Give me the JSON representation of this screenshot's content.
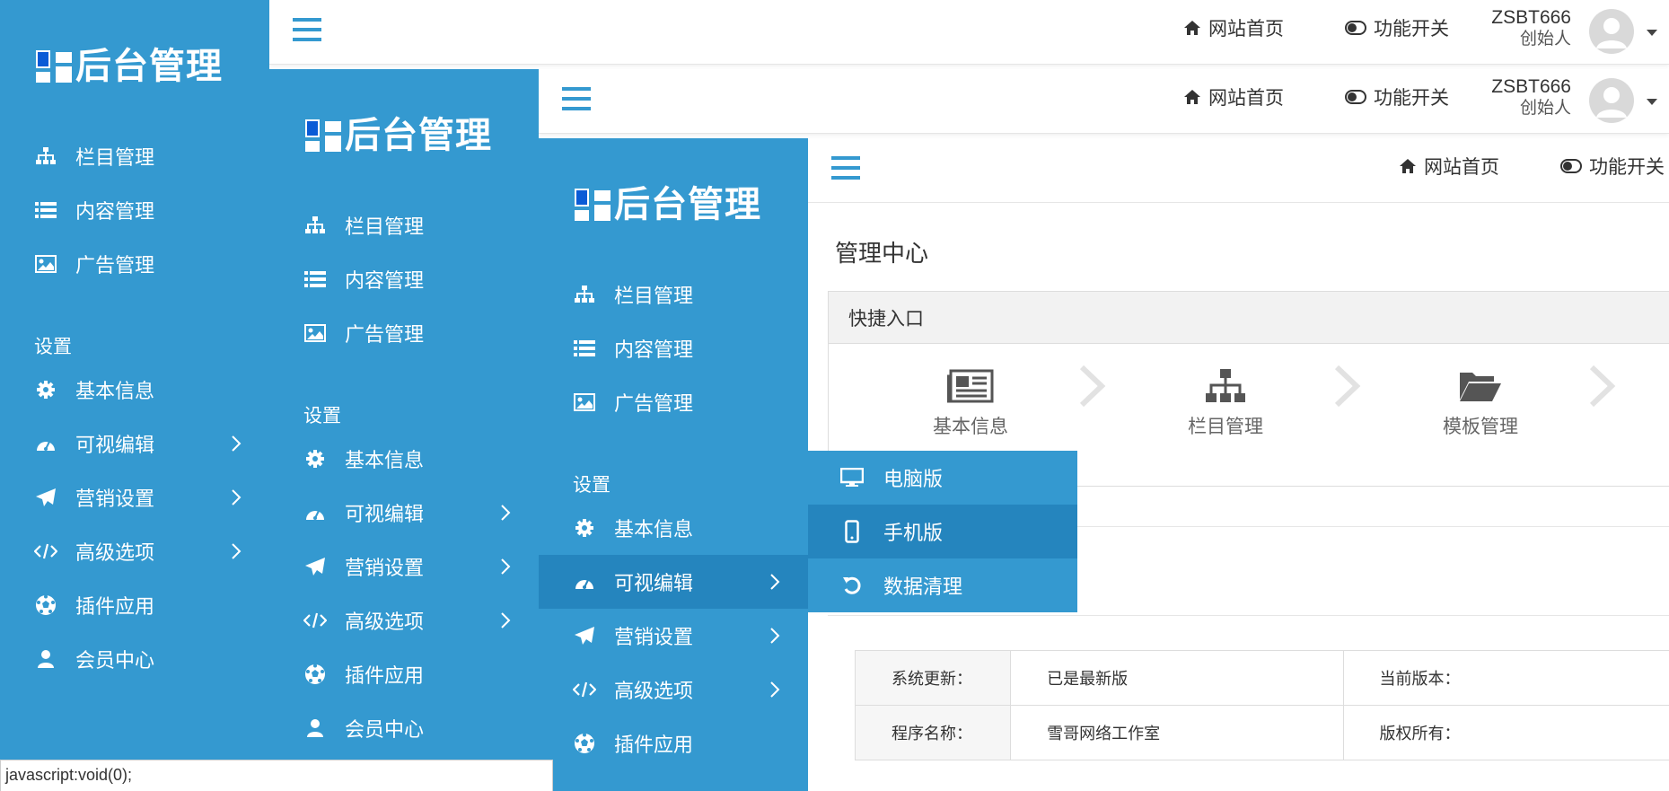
{
  "brand": {
    "logo_text": "后台管理"
  },
  "header": {
    "home_link": "网站首页",
    "feature_toggle": "功能开关",
    "user_name": "ZSBT666",
    "user_role": "创始人"
  },
  "sidebar": {
    "items": [
      {
        "label": "栏目管理",
        "icon": "sitemap-icon"
      },
      {
        "label": "内容管理",
        "icon": "list-icon"
      },
      {
        "label": "广告管理",
        "icon": "image-icon"
      }
    ],
    "section_label": "设置",
    "settings_items": [
      {
        "label": "基本信息",
        "icon": "gear-icon"
      },
      {
        "label": "可视编辑",
        "icon": "dashboard-icon",
        "has_children": true
      },
      {
        "label": "营销设置",
        "icon": "paper-plane-icon",
        "has_children": true
      },
      {
        "label": "高级选项",
        "icon": "code-icon",
        "has_children": true
      },
      {
        "label": "插件应用",
        "icon": "soccer-ball-icon"
      },
      {
        "label": "会员中心",
        "icon": "user-icon"
      }
    ]
  },
  "submenu": {
    "items": [
      {
        "label": "电脑版",
        "icon": "desktop-icon"
      },
      {
        "label": "手机版",
        "icon": "mobile-icon"
      },
      {
        "label": "数据清理",
        "icon": "undo-icon"
      }
    ]
  },
  "main": {
    "page_title": "管理中心",
    "quick_panel_title": "快捷入口",
    "quick_entries": [
      {
        "label": "基本信息",
        "icon": "newspaper-icon"
      },
      {
        "label": "栏目管理",
        "icon": "sitemap-icon"
      },
      {
        "label": "模板管理",
        "icon": "folder-open-icon"
      }
    ],
    "info_table": [
      {
        "k1": "系统更新：",
        "v1": "已是最新版",
        "k2": "当前版本："
      },
      {
        "k1": "程序名称：",
        "v1": "雪哥网络工作室",
        "k2": "版权所有："
      }
    ]
  },
  "statusbar": {
    "text": "javascript:void(0);"
  },
  "colors": {
    "sidebar": "#3499d0",
    "sidebar_active": "#2585be",
    "accent": "#3499d0"
  }
}
